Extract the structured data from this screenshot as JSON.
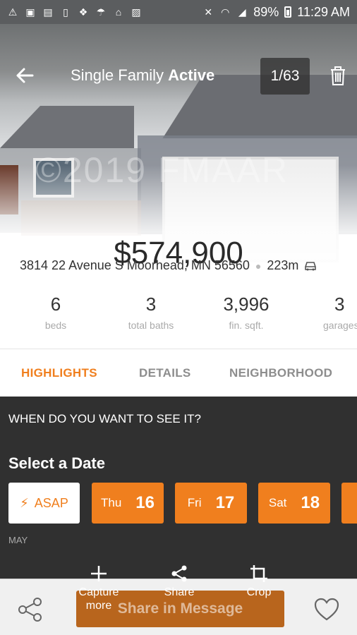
{
  "status_bar": {
    "battery": "89%",
    "time": "11:29 AM",
    "left_icons": [
      "warning-icon",
      "image-icon",
      "gallery-icon",
      "sd-card-icon",
      "dropbox-icon",
      "weather-icon",
      "home-icon",
      "photo-icon"
    ],
    "right_icons": [
      "mute-icon",
      "wifi-icon",
      "signal-icon",
      "battery-icon"
    ]
  },
  "header": {
    "title_prefix": "Single Family",
    "title_status": "Active",
    "counter": "1/63",
    "watermark": "©2019 FMAAR"
  },
  "listing": {
    "price": "$574,900",
    "address": "3814 22 Avenue S Moorhead, MN 56560",
    "distance": "223m"
  },
  "stats": [
    {
      "value": "6",
      "label": "beds"
    },
    {
      "value": "3",
      "label": "total baths"
    },
    {
      "value": "3,996",
      "label": "fin. sqft."
    },
    {
      "value": "3",
      "label": "garages"
    }
  ],
  "tabs": [
    "HIGHLIGHTS",
    "DETAILS",
    "NEIGHBORHOOD"
  ],
  "schedule": {
    "question": "WHEN DO YOU WANT TO SEE IT?",
    "select_title": "Select a Date",
    "asap": "ASAP",
    "dates": [
      {
        "day": "Thu",
        "num": "16"
      },
      {
        "day": "Fri",
        "num": "17"
      },
      {
        "day": "Sat",
        "num": "18"
      }
    ],
    "month": "MAY"
  },
  "screenshot_tools": {
    "capture_more": "Capture more",
    "share": "Share",
    "crop": "Crop"
  },
  "bottom": {
    "share_message": "Share in Message"
  },
  "colors": {
    "accent": "#f07f1e",
    "panel": "#303030"
  }
}
